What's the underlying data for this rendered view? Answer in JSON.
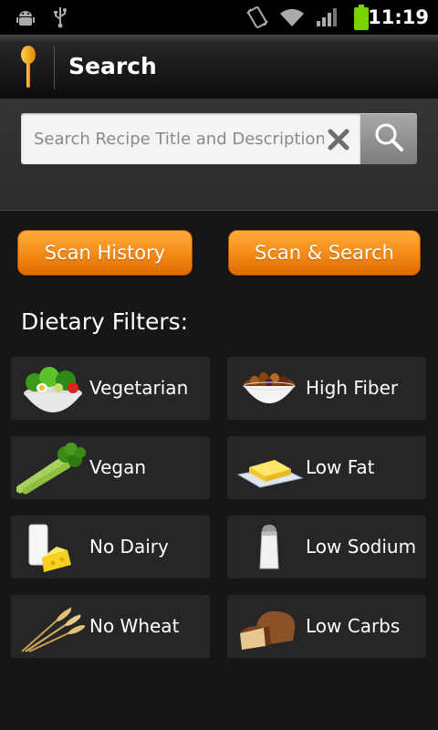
{
  "status_bar": {
    "time": "11:19",
    "icons": [
      "android-debug-icon",
      "usb-icon",
      "rotate-icon",
      "wifi-icon",
      "signal-icon",
      "battery-icon"
    ]
  },
  "title_bar": {
    "title": "Search",
    "app_icon": "spoon-icon"
  },
  "search": {
    "placeholder": "Search Recipe Title and Description",
    "value": "",
    "clear_icon": "close-icon",
    "button_icon": "search-icon"
  },
  "actions": {
    "scan_history": "Scan History",
    "scan_search": "Scan & Search"
  },
  "filters": {
    "heading": "Dietary Filters:",
    "items": [
      {
        "label": "Vegetarian",
        "icon": "salad-icon"
      },
      {
        "label": "High Fiber",
        "icon": "cereal-bowl-icon"
      },
      {
        "label": "Vegan",
        "icon": "celery-icon"
      },
      {
        "label": "Low Fat",
        "icon": "butter-icon"
      },
      {
        "label": "No Dairy",
        "icon": "milk-cheese-icon"
      },
      {
        "label": "Low Sodium",
        "icon": "salt-shaker-icon"
      },
      {
        "label": "No Wheat",
        "icon": "wheat-icon"
      },
      {
        "label": "Low Carbs",
        "icon": "bread-icon"
      }
    ]
  },
  "colors": {
    "accent": "#f7901a",
    "background": "#161616",
    "card": "#262626"
  }
}
